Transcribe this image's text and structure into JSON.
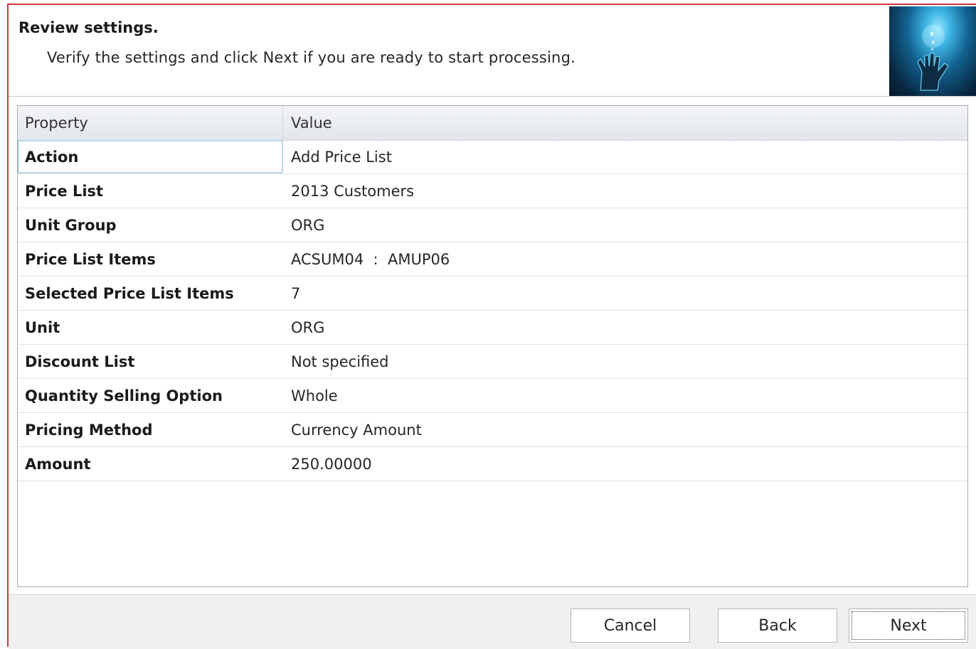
{
  "header": {
    "title": "Review settings.",
    "subtitle": "Verify the settings and click Next if you are ready to start processing.",
    "image_icon": "hand-light-icon"
  },
  "grid": {
    "columns": [
      "Property",
      "Value"
    ],
    "rows": [
      {
        "property": "Action",
        "value": "Add Price List"
      },
      {
        "property": "Price List",
        "value": "2013 Customers"
      },
      {
        "property": "Unit Group",
        "value": "ORG"
      },
      {
        "property": "Price List Items",
        "value": "ACSUM04  :  AMUP06"
      },
      {
        "property": "Selected Price List Items",
        "value": "7"
      },
      {
        "property": "Unit",
        "value": "ORG"
      },
      {
        "property": "Discount List",
        "value": "Not specified"
      },
      {
        "property": "Quantity Selling Option",
        "value": "Whole"
      },
      {
        "property": "Pricing Method",
        "value": "Currency Amount"
      },
      {
        "property": "Amount",
        "value": "250.00000"
      }
    ]
  },
  "footer": {
    "cancel_label": "Cancel",
    "back_label": "Back",
    "next_label": "Next"
  },
  "colors": {
    "frame_border": "#d4343a",
    "selected_cell_border": "#b7d8e8"
  }
}
